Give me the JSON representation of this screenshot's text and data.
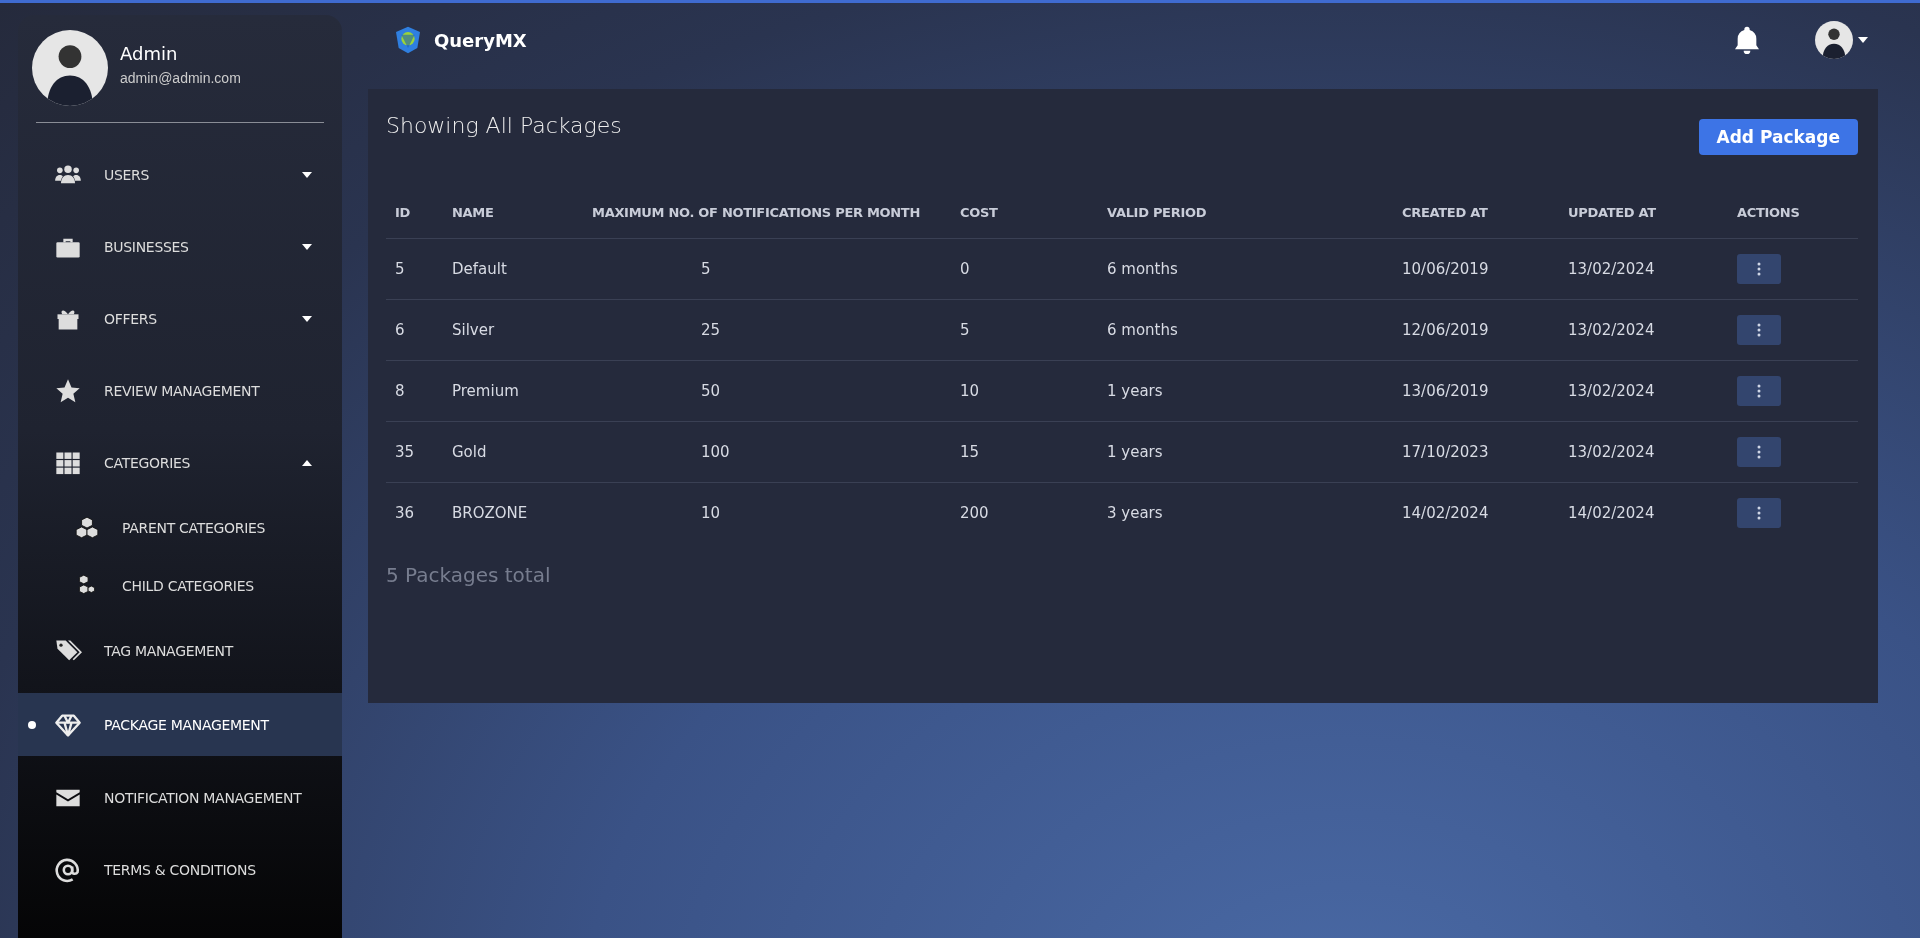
{
  "profile": {
    "name": "Admin",
    "email": "admin@admin.com"
  },
  "sidebar": {
    "items": [
      {
        "label": "USERS",
        "expanded": false,
        "selected": false
      },
      {
        "label": "BUSINESSES",
        "expanded": false,
        "selected": false
      },
      {
        "label": "OFFERS",
        "expanded": false,
        "selected": false
      },
      {
        "label": "REVIEW MANAGEMENT",
        "selected": false
      },
      {
        "label": "CATEGORIES",
        "expanded": true,
        "selected": false,
        "children": [
          {
            "label": "PARENT CATEGORIES",
            "selected": false
          },
          {
            "label": "CHILD CATEGORIES",
            "selected": false
          }
        ]
      },
      {
        "label": "TAG MANAGEMENT",
        "selected": false
      },
      {
        "label": "PACKAGE MANAGEMENT",
        "selected": true
      },
      {
        "label": "NOTIFICATION MANAGEMENT",
        "selected": false
      },
      {
        "label": "TERMS & CONDITIONS",
        "selected": false
      }
    ]
  },
  "header": {
    "brand": "QueryMX"
  },
  "page": {
    "title": "Showing All Packages",
    "add_button": "Add Package",
    "footer": "5 Packages total"
  },
  "table": {
    "columns": [
      "ID",
      "NAME",
      "MAXIMUM NO. OF NOTIFICATIONS PER MONTH",
      "COST",
      "VALID PERIOD",
      "CREATED AT",
      "UPDATED AT",
      "ACTIONS"
    ],
    "rows": [
      [
        "5",
        "Default",
        "5",
        "0",
        "6 months",
        "10/06/2019",
        "13/02/2024"
      ],
      [
        "6",
        "Silver",
        "25",
        "5",
        "6 months",
        "12/06/2019",
        "13/02/2024"
      ],
      [
        "8",
        "Premium",
        "50",
        "10",
        "1 years",
        "13/06/2019",
        "13/02/2024"
      ],
      [
        "35",
        "Gold",
        "100",
        "15",
        "1 years",
        "17/10/2023",
        "13/02/2024"
      ],
      [
        "36",
        "BROZONE",
        "10",
        "200",
        "3 years",
        "14/02/2024",
        "14/02/2024"
      ]
    ]
  }
}
